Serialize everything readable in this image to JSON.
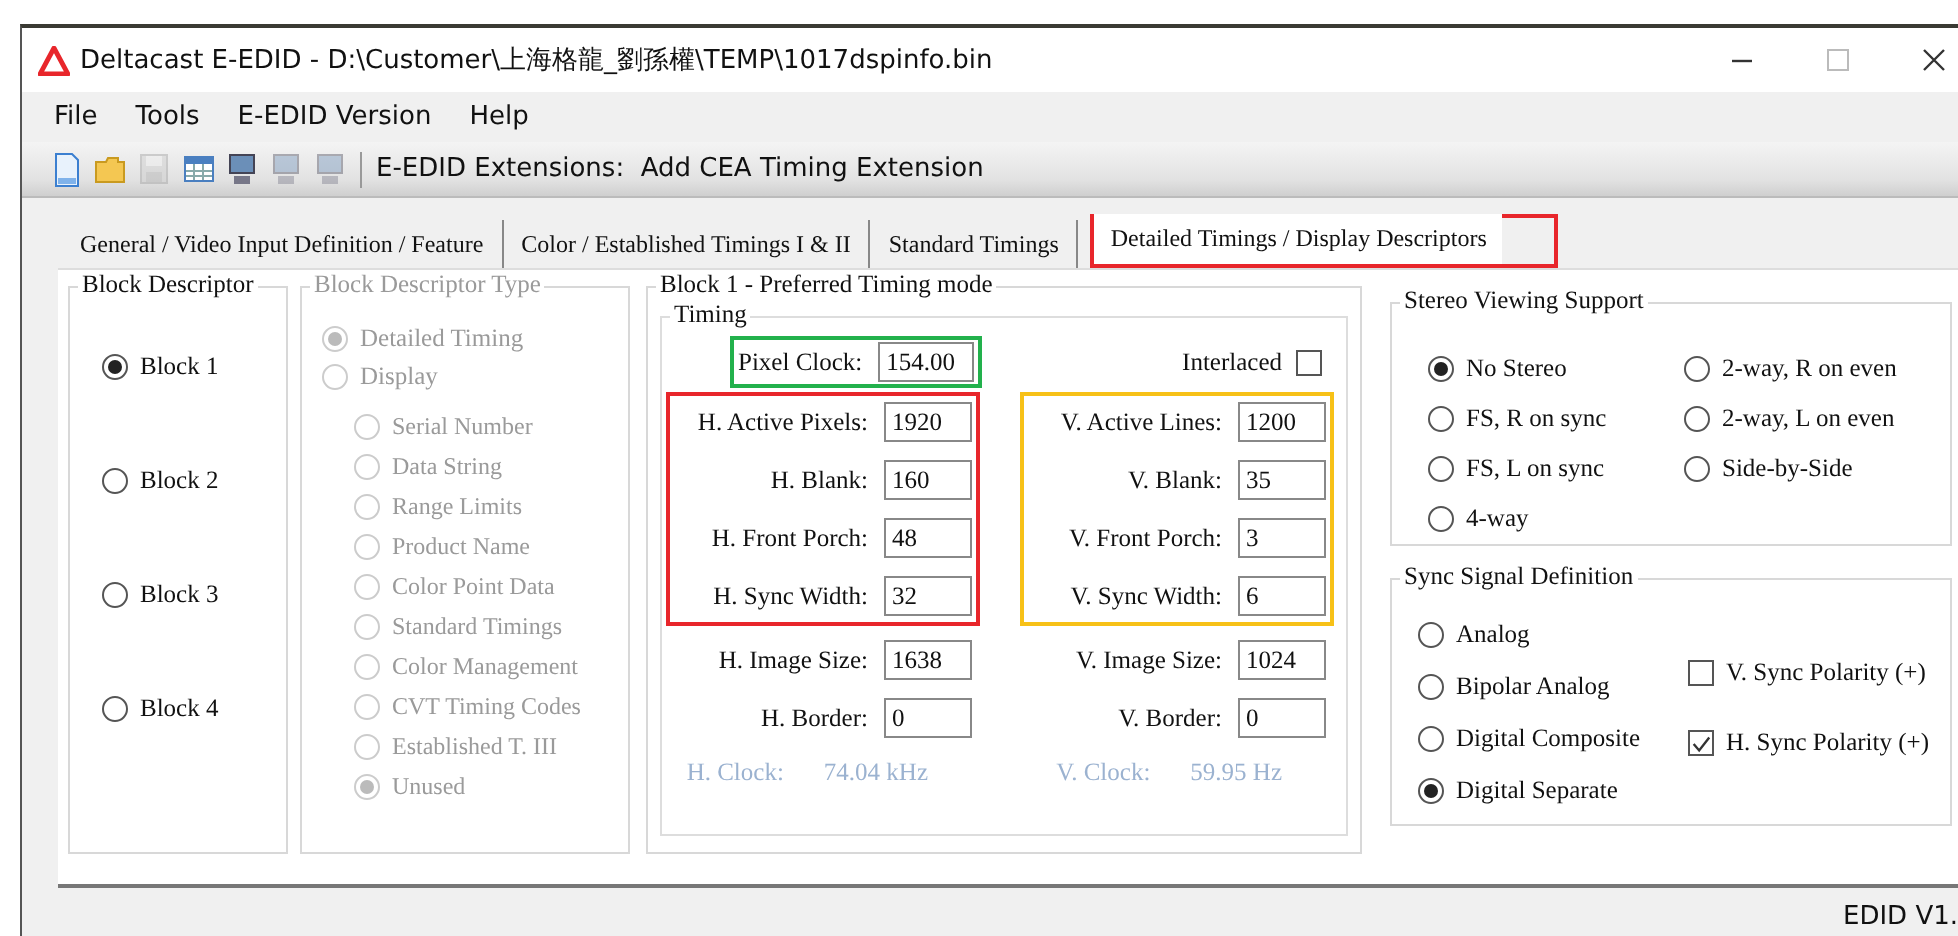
{
  "window": {
    "title": "Deltacast E-EDID - D:\\Customer\\上海格龍_劉孫權\\TEMP\\1017dspinfo.bin"
  },
  "menu": [
    "File",
    "Tools",
    "E-EDID Version",
    "Help"
  ],
  "toolbar": {
    "icons": [
      {
        "kind": "document",
        "disabled": false
      },
      {
        "kind": "folder",
        "disabled": false
      },
      {
        "kind": "floppy",
        "disabled": true
      },
      {
        "kind": "table",
        "disabled": false
      },
      {
        "kind": "monitor",
        "disabled": false
      },
      {
        "kind": "monitor",
        "disabled": true
      },
      {
        "kind": "monitor",
        "disabled": true
      }
    ],
    "label": "E-EDID Extensions:  Add CEA Timing Extension"
  },
  "tabs": [
    {
      "label": "General / Video Input Definition / Feature",
      "selected": false
    },
    {
      "label": "Color / Established Timings I & II",
      "selected": false
    },
    {
      "label": "Standard Timings",
      "selected": false
    },
    {
      "label": "Detailed Timings / Display Descriptors",
      "selected": true,
      "color": "#e8262b"
    }
  ],
  "block_descriptor": {
    "title": "Block Descriptor",
    "options": [
      {
        "label": "Block 1",
        "selected": true
      },
      {
        "label": "Block 2",
        "selected": false
      },
      {
        "label": "Block 3",
        "selected": false
      },
      {
        "label": "Block 4",
        "selected": false
      }
    ]
  },
  "block_type": {
    "title": "Block Descriptor Type",
    "disabled": true,
    "options": [
      {
        "label": "Detailed Timing",
        "selected": true
      },
      {
        "label": "Display",
        "selected": false,
        "children": [
          {
            "label": "Serial Number",
            "selected": false
          },
          {
            "label": "Data String",
            "selected": false
          },
          {
            "label": "Range Limits",
            "selected": false
          },
          {
            "label": "Product Name",
            "selected": false
          },
          {
            "label": "Color Point Data",
            "selected": false
          },
          {
            "label": "Standard Timings",
            "selected": false
          },
          {
            "label": "Color Management",
            "selected": false
          },
          {
            "label": "CVT Timing Codes",
            "selected": false
          },
          {
            "label": "Established T. III",
            "selected": false
          },
          {
            "label": "Unused",
            "selected": true
          }
        ]
      }
    ]
  },
  "timing_panel": {
    "title": "Block 1 -  Preferred Timing mode",
    "group_title": "Timing",
    "pixel_clock": {
      "label": "Pixel Clock:",
      "value": "154.00",
      "color": "#22b14c"
    },
    "interlaced": {
      "label": "Interlaced",
      "checked": false
    },
    "columns": [
      {
        "groups": [
          {
            "color": "#e8262b",
            "fields": [
              {
                "label": "H. Active Pixels:",
                "value": "1920"
              },
              {
                "label": "H. Blank:",
                "value": "160"
              },
              {
                "label": "H. Front Porch:",
                "value": "48"
              },
              {
                "label": "H. Sync Width:",
                "value": "32"
              }
            ]
          },
          {
            "fields": [
              {
                "label": "H. Image Size:",
                "value": "1638"
              },
              {
                "label": "H. Border:",
                "value": "0"
              }
            ]
          }
        ],
        "clock": {
          "label": "H. Clock:",
          "value": "74.04 kHz",
          "disabled": true
        }
      },
      {
        "groups": [
          {
            "color": "#f7c117",
            "fields": [
              {
                "label": "V. Active Lines:",
                "value": "1200"
              },
              {
                "label": "V. Blank:",
                "value": "35"
              },
              {
                "label": "V. Front Porch:",
                "value": "3"
              },
              {
                "label": "V. Sync Width:",
                "value": "6"
              }
            ]
          },
          {
            "fields": [
              {
                "label": "V. Image Size:",
                "value": "1024"
              },
              {
                "label": "V. Border:",
                "value": "0"
              }
            ]
          }
        ],
        "clock": {
          "label": "V. Clock:",
          "value": "59.95 Hz",
          "disabled": true
        }
      }
    ]
  },
  "stereo": {
    "title": "Stereo Viewing Support",
    "options": [
      {
        "label": "No Stereo",
        "selected": true
      },
      {
        "label": "FS, R on sync",
        "selected": false
      },
      {
        "label": "FS, L on sync",
        "selected": false
      },
      {
        "label": "4-way",
        "selected": false
      },
      {
        "label": "2-way, R on even",
        "selected": false
      },
      {
        "label": "2-way, L on even",
        "selected": false
      },
      {
        "label": "Side-by-Side",
        "selected": false
      }
    ]
  },
  "sync": {
    "title": "Sync Signal Definition",
    "options": [
      {
        "label": "Analog",
        "selected": false
      },
      {
        "label": "Bipolar Analog",
        "selected": false
      },
      {
        "label": "Digital Composite",
        "selected": false
      },
      {
        "label": "Digital Separate",
        "selected": true
      }
    ],
    "checkboxes": [
      {
        "label": "V. Sync Polarity (+)",
        "checked": false
      },
      {
        "label": "H. Sync Polarity (+)",
        "checked": true
      }
    ]
  },
  "status_bar": "EDID V1."
}
